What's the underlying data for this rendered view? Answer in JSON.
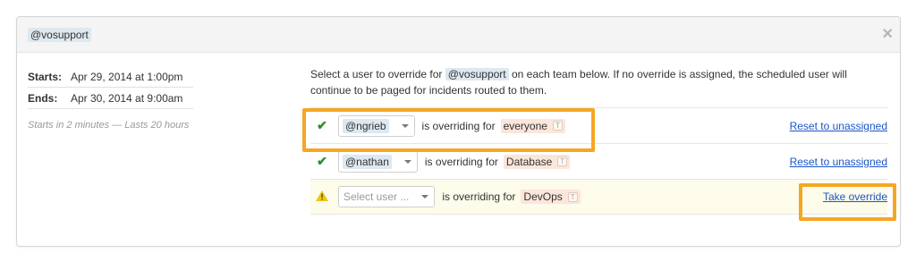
{
  "header": {
    "handle": "@vosupport",
    "close_icon": "×"
  },
  "schedule": {
    "starts_label": "Starts:",
    "starts_value": "Apr 29, 2014 at 1:00pm",
    "ends_label": "Ends:",
    "ends_value": "Apr 30, 2014 at 9:00am",
    "summary": "Starts in 2 minutes — Lasts 20 hours"
  },
  "intro": {
    "before": "Select a user to override for ",
    "handle": "@vosupport",
    "after": " on each team below. If no override is assigned, the scheduled user will continue to be paged for incidents routed to them."
  },
  "rows": [
    {
      "status_icon": "check-icon",
      "user": "@ngrieb",
      "middle": "is overriding for",
      "team": "everyone",
      "team_tag": "T",
      "action": "Reset to unassigned"
    },
    {
      "status_icon": "check-icon",
      "user": "@nathan",
      "middle": "is overriding for",
      "team": "Database",
      "team_tag": "T",
      "action": "Reset to unassigned"
    },
    {
      "status_icon": "warning-icon",
      "placeholder": "Select user ...",
      "middle": "is overriding for",
      "team": "DevOps",
      "team_tag": "T",
      "action": "Take override"
    }
  ],
  "colors": {
    "highlight": "#f5a623",
    "link": "#1a56c8",
    "check": "#2e8b2e",
    "warning": "#f0c419"
  }
}
